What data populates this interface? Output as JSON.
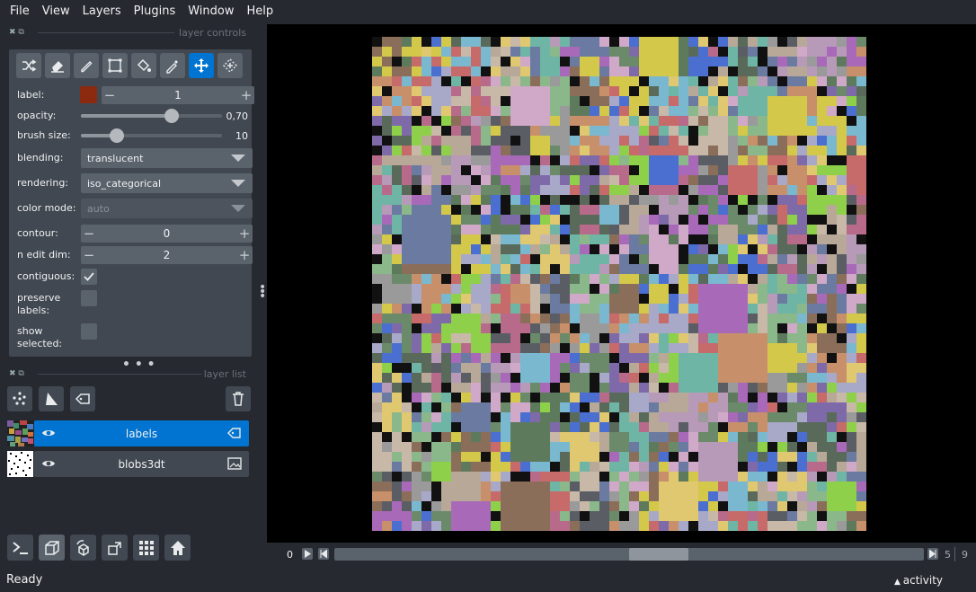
{
  "menu": [
    "File",
    "View",
    "Layers",
    "Plugins",
    "Window",
    "Help"
  ],
  "layer_controls": {
    "title": "layer controls",
    "tools": [
      "shuffle-icon",
      "eraser-icon",
      "brush-icon",
      "polygon-icon",
      "fill-icon",
      "picker-icon",
      "move-icon",
      "transform-icon"
    ],
    "active_tool": "move-icon",
    "label": {
      "name": "label:",
      "value": "1",
      "color": "#8c2a0f"
    },
    "opacity": {
      "name": "opacity:",
      "value": "0,70",
      "fraction": 0.7
    },
    "brush_size": {
      "name": "brush size:",
      "value": "10",
      "fraction": 0.27
    },
    "blending": {
      "name": "blending:",
      "value": "translucent"
    },
    "rendering": {
      "name": "rendering:",
      "value": "iso_categorical"
    },
    "color_mode": {
      "name": "color mode:",
      "value": "auto"
    },
    "contour": {
      "name": "contour:",
      "value": "0"
    },
    "n_edit_dim": {
      "name": "n edit dim:",
      "value": "2"
    },
    "contiguous": {
      "name": "contiguous:",
      "checked": true
    },
    "preserve_labels": {
      "name": "preserve labels:",
      "checked": false
    },
    "show_selected": {
      "name": "show selected:",
      "checked": false
    }
  },
  "layer_list": {
    "title": "layer list",
    "layers": [
      {
        "name": "labels",
        "selected": true,
        "kind": "label-layer-icon"
      },
      {
        "name": "blobs3dt",
        "selected": false,
        "kind": "image-layer-icon"
      }
    ]
  },
  "dims": {
    "start": "0",
    "current": "5",
    "total": "9",
    "position_fraction": 0.5
  },
  "status": {
    "text": "Ready",
    "activity": "activity"
  },
  "colors": {
    "accent": "#0074d0",
    "background": "#262930",
    "panel": "#414851"
  }
}
